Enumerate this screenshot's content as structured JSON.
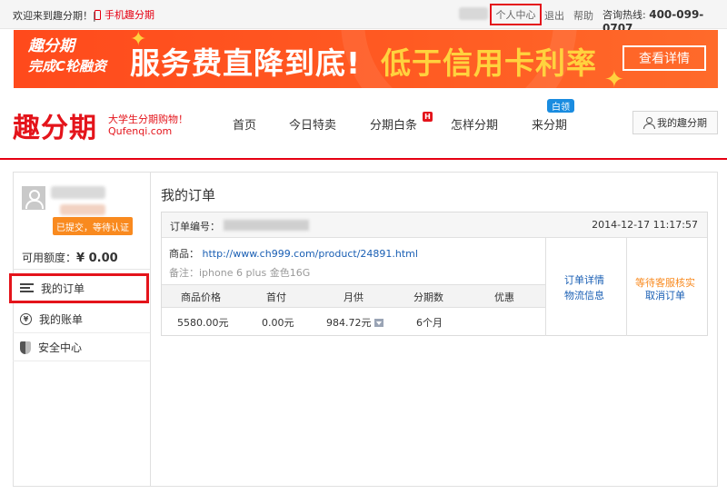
{
  "topbar": {
    "welcome": "欢迎来到趣分期！|",
    "mobile_link": "手机趣分期",
    "personal_center": "个人中心",
    "logout": "退出",
    "help": "帮助",
    "hotline_label": "咨询热线:",
    "hotline_number": "400-099-0707"
  },
  "banner": {
    "left_line1": "趣分期",
    "left_line2": "完成C轮融资",
    "headline": "服务费直降到底!",
    "headline_highlight": "低于信用卡利率",
    "button": "查看详情",
    "accent_color": "#ffd23e",
    "bg_color": "#ff4a1c"
  },
  "header": {
    "logo": "趣分期",
    "slogan": "大学生分期购物！",
    "slogan_domain": "Qufenqi.com",
    "nav": [
      "首页",
      "今日特卖",
      "分期白条",
      "怎样分期",
      "来分期"
    ],
    "hot_badge": "H",
    "white_badge": "白领",
    "my_account": "我的趣分期"
  },
  "sidebar": {
    "status_badge": "已提交，等待认证",
    "credit_label": "可用额度：",
    "credit_value": "¥ 0.00",
    "items": [
      {
        "label": "我的订单",
        "icon": "list-icon"
      },
      {
        "label": "我的账单",
        "icon": "yen-icon"
      },
      {
        "label": "安全中心",
        "icon": "shield-icon"
      }
    ]
  },
  "content": {
    "title": "我的订单",
    "order": {
      "number_label": "订单编号：",
      "time": "2014-12-17 11:17:57",
      "goods_label": "商品：",
      "goods_link": "http://www.ch999.com/product/24891.html",
      "remark": "备注：iphone 6 plus 金色16G",
      "columns": [
        "商品价格",
        "首付",
        "月供",
        "分期数",
        "优惠"
      ],
      "values": [
        "5580.00元",
        "0.00元",
        "984.72元",
        "6个月",
        ""
      ],
      "links": [
        "订单详情",
        "物流信息"
      ],
      "status": "等待客服核实",
      "cancel": "取消订单"
    }
  },
  "colors": {
    "brand_red": "#e4141b",
    "link_blue": "#1a5fb4",
    "orange": "#f98a1f"
  }
}
